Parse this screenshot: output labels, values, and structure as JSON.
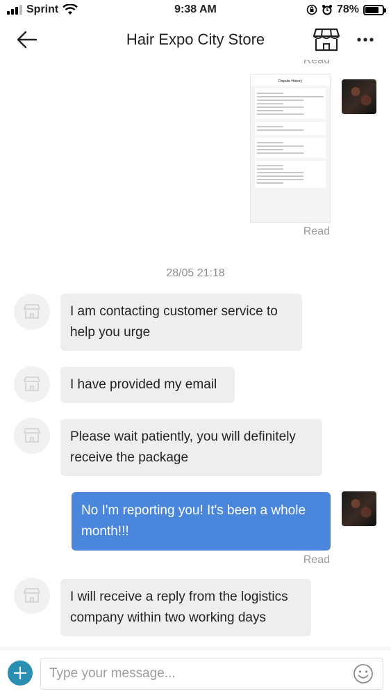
{
  "status_bar": {
    "carrier": "Sprint",
    "time": "9:38 AM",
    "battery": "78%",
    "battery_level": 0.78,
    "icons": [
      "signal-icon",
      "wifi-icon",
      "lock-rotation-icon",
      "alarm-icon",
      "battery-icon"
    ]
  },
  "header": {
    "title": "Hair Expo City Store",
    "icons": [
      "back-arrow-icon",
      "store-icon",
      "more-icon"
    ]
  },
  "screenshot_message": {
    "title": "Dispute History"
  },
  "read_label": "Read",
  "timestamp": "28/05 21:18",
  "messages": [
    {
      "from": "store",
      "text": "I am contacting customer service to help you urge"
    },
    {
      "from": "store",
      "text": "I have provided my email"
    },
    {
      "from": "store",
      "text": "Please wait patiently, you will definitely receive the package"
    },
    {
      "from": "me",
      "text": "No I'm reporting you! It's been a whole month!!!"
    },
    {
      "from": "store",
      "text": "I will receive a reply from the logistics company within two working days"
    }
  ],
  "composer": {
    "placeholder": "Type your message...",
    "icons": [
      "plus-icon",
      "emoji-icon"
    ]
  },
  "colors": {
    "outgoing_bubble": "#4a87dc",
    "incoming_bubble": "#eeeeee",
    "plus_button": "#2a8fb3",
    "read_text": "#9a9a9a"
  }
}
